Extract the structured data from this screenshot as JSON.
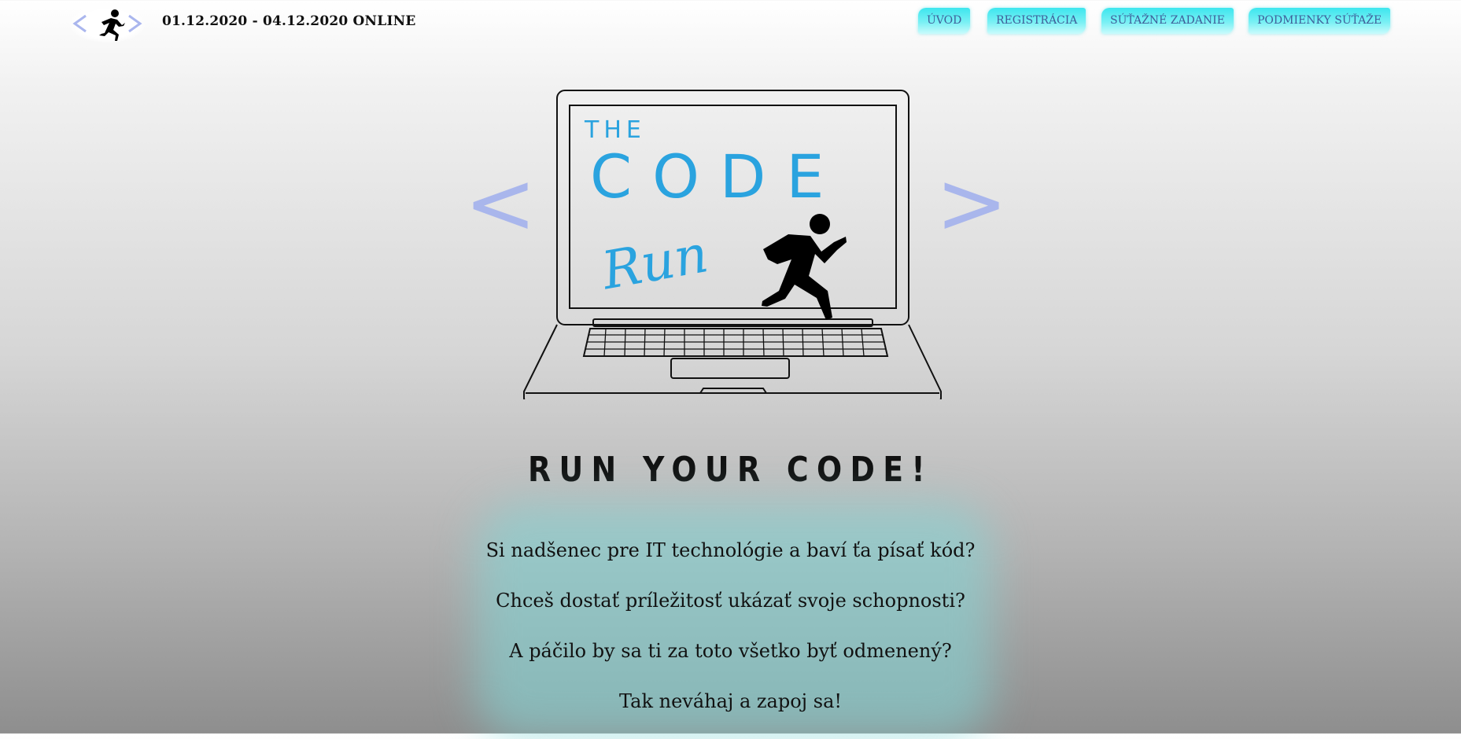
{
  "header": {
    "date_text": "01.12.2020 - 04.12.2020 ONLINE",
    "nav": [
      {
        "label": "ÚVOD"
      },
      {
        "label": "REGISTRÁCIA"
      },
      {
        "label": "SÚŤAŽNÉ ZADANIE"
      },
      {
        "label": "PODMIENKY SÚŤAŽE"
      }
    ]
  },
  "hero": {
    "logo_text_the": "THE",
    "logo_text_code": "CODE",
    "logo_text_run": "Run",
    "bracket_left": "<",
    "bracket_right": ">"
  },
  "slogan": "RUN YOUR CODE!",
  "questions": [
    "Si nadšenec pre IT technológie a baví ťa písať kód?",
    "Chceš dostať príležitosť ukázať svoje schopnosti?",
    "A páčilo by sa ti za toto všetko byť odmenený?",
    "Tak neváhaj a zapoj sa!"
  ],
  "colors": {
    "accent_blue": "#2aa3df",
    "bracket": "#a9b6ec",
    "nav_bg": "#49e9f0",
    "nav_text": "#3f5e99"
  },
  "icons": {
    "logo": "runner-icon",
    "hero_runner": "runner-icon",
    "laptop": "laptop-icon"
  }
}
